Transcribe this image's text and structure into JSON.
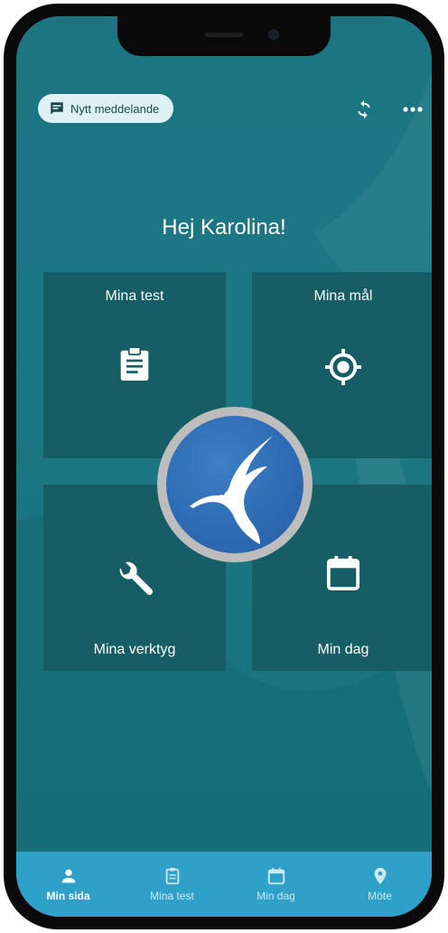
{
  "header": {
    "new_message_label": "Nytt meddelande",
    "sync_icon": "sync-icon",
    "more_icon": "more-horizontal-icon"
  },
  "greeting": "Hej Karolina!",
  "tiles": [
    {
      "label": "Mina test",
      "icon": "clipboard-icon"
    },
    {
      "label": "Mina mål",
      "icon": "target-icon"
    },
    {
      "label": "Mina verktyg",
      "icon": "wrench-icon"
    },
    {
      "label": "Min dag",
      "icon": "calendar-icon"
    }
  ],
  "logo": {
    "icon": "hummingbird-logo-icon"
  },
  "bottom_nav": {
    "items": [
      {
        "label": "Min sida",
        "icon": "person-icon",
        "active": true
      },
      {
        "label": "Mina test",
        "icon": "clipboard-icon",
        "active": false
      },
      {
        "label": "Min dag",
        "icon": "calendar-icon",
        "active": false
      },
      {
        "label": "Möte",
        "icon": "location-pin-icon",
        "active": false
      }
    ]
  },
  "colors": {
    "background": "#1b7784",
    "tile": "#175d66",
    "nav_bar": "#2fa0c8",
    "logo_blue": "#2d6cb4"
  }
}
